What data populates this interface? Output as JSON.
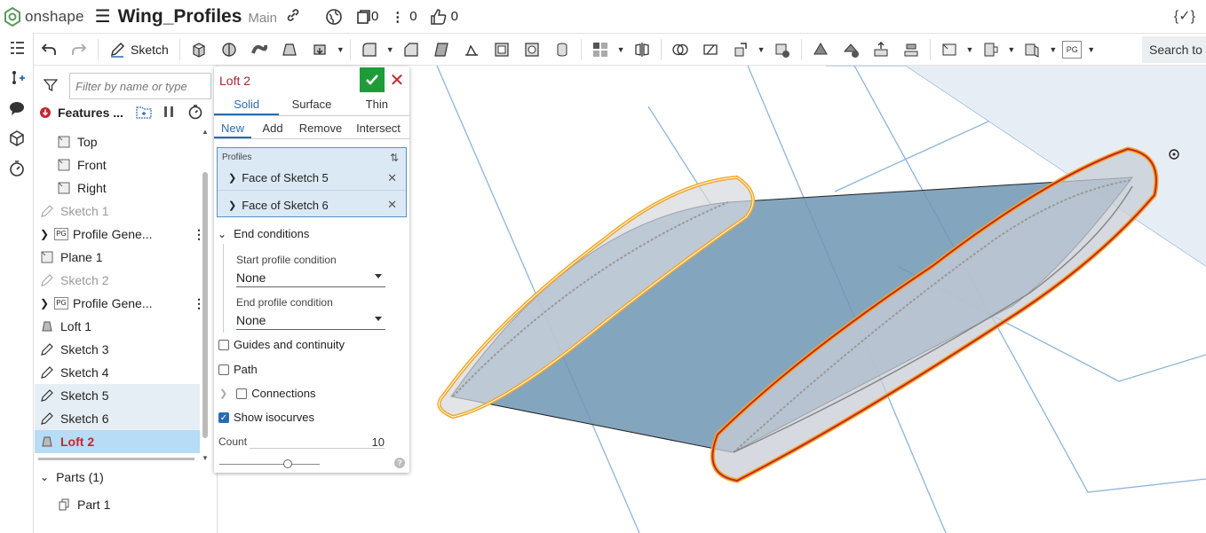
{
  "header": {
    "brand": "onshape",
    "doc_title": "Wing_Profiles",
    "branch": "Main",
    "versions_count": "0",
    "info_count": "0",
    "likes_count": "0"
  },
  "toolbar": {
    "sketch_label": "Sketch",
    "search_label": "Search to",
    "pg_label": "PG"
  },
  "tree": {
    "filter_placeholder": "Filter by name or type",
    "features_label": "Features ...",
    "items": [
      {
        "label": "Top"
      },
      {
        "label": "Front"
      },
      {
        "label": "Right"
      },
      {
        "label": "Sketch 1"
      },
      {
        "label": "Profile Gene...",
        "badge": "PG"
      },
      {
        "label": "Plane 1"
      },
      {
        "label": "Sketch 2"
      },
      {
        "label": "Profile Gene...",
        "badge": "PG"
      },
      {
        "label": "Loft 1"
      },
      {
        "label": "Sketch 3"
      },
      {
        "label": "Sketch 4"
      },
      {
        "label": "Sketch 5"
      },
      {
        "label": "Sketch 6"
      },
      {
        "label": "Loft 2"
      }
    ],
    "parts_label": "Parts (1)",
    "part_item": "Part 1"
  },
  "dialog": {
    "title": "Loft 2",
    "tabs": [
      "Solid",
      "Surface",
      "Thin"
    ],
    "ops": [
      "New",
      "Add",
      "Remove",
      "Intersect"
    ],
    "profiles_label": "Profiles",
    "profiles": [
      "Face of Sketch 5",
      "Face of Sketch 6"
    ],
    "end_conditions_label": "End conditions",
    "start_label": "Start profile condition",
    "start_value": "None",
    "end_label": "End profile condition",
    "end_value": "None",
    "guides_label": "Guides and continuity",
    "path_label": "Path",
    "connections_label": "Connections",
    "isocurves_label": "Show isocurves",
    "count_label": "Count",
    "count_value": "10",
    "count_slider_fraction": 0.68
  },
  "colors": {
    "accent": "#2a6cb0",
    "ok_green": "#1e9c3a",
    "loft_red": "#c0282f",
    "highlight_orange": "#f5a623"
  }
}
